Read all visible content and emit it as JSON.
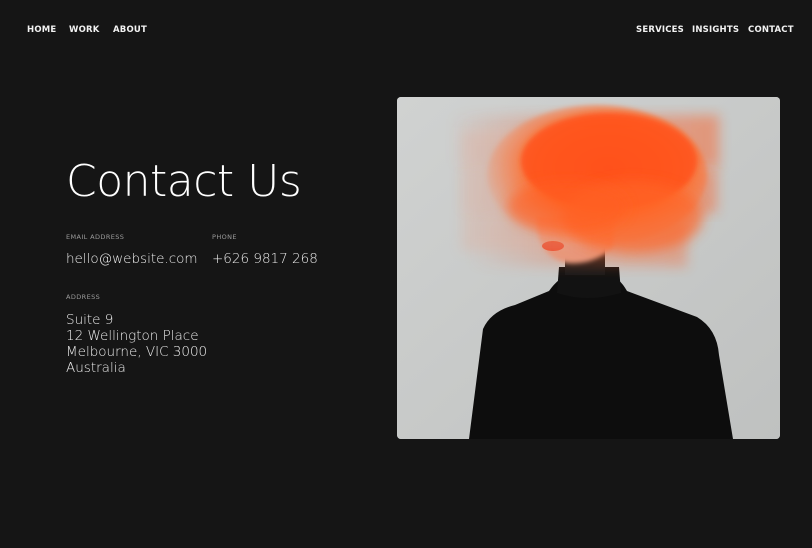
{
  "nav": {
    "left": [
      {
        "label": "HOME"
      },
      {
        "label": "WORK"
      },
      {
        "label": "ABOUT"
      }
    ],
    "right": [
      {
        "label": "SERVICES"
      },
      {
        "label": "INSIGHTS"
      },
      {
        "label": "CONTACT"
      }
    ]
  },
  "page": {
    "title": "Contact Us"
  },
  "contact": {
    "email_label": "EMAIL ADDRESS",
    "email": "hello@website.com",
    "phone_label": "PHONE",
    "phone": "+626 9817 268",
    "address_label": "ADDRESS",
    "address_lines": [
      "Suite 9",
      "12 Wellington Place",
      "Melbourne, VIC 3000",
      "Australia"
    ]
  },
  "colors": {
    "background": "#151515",
    "text": "#ffffff",
    "muted": "#9b9b9b",
    "accent_orange": "#ff5a1f",
    "photo_bg": "#c9cbca"
  }
}
